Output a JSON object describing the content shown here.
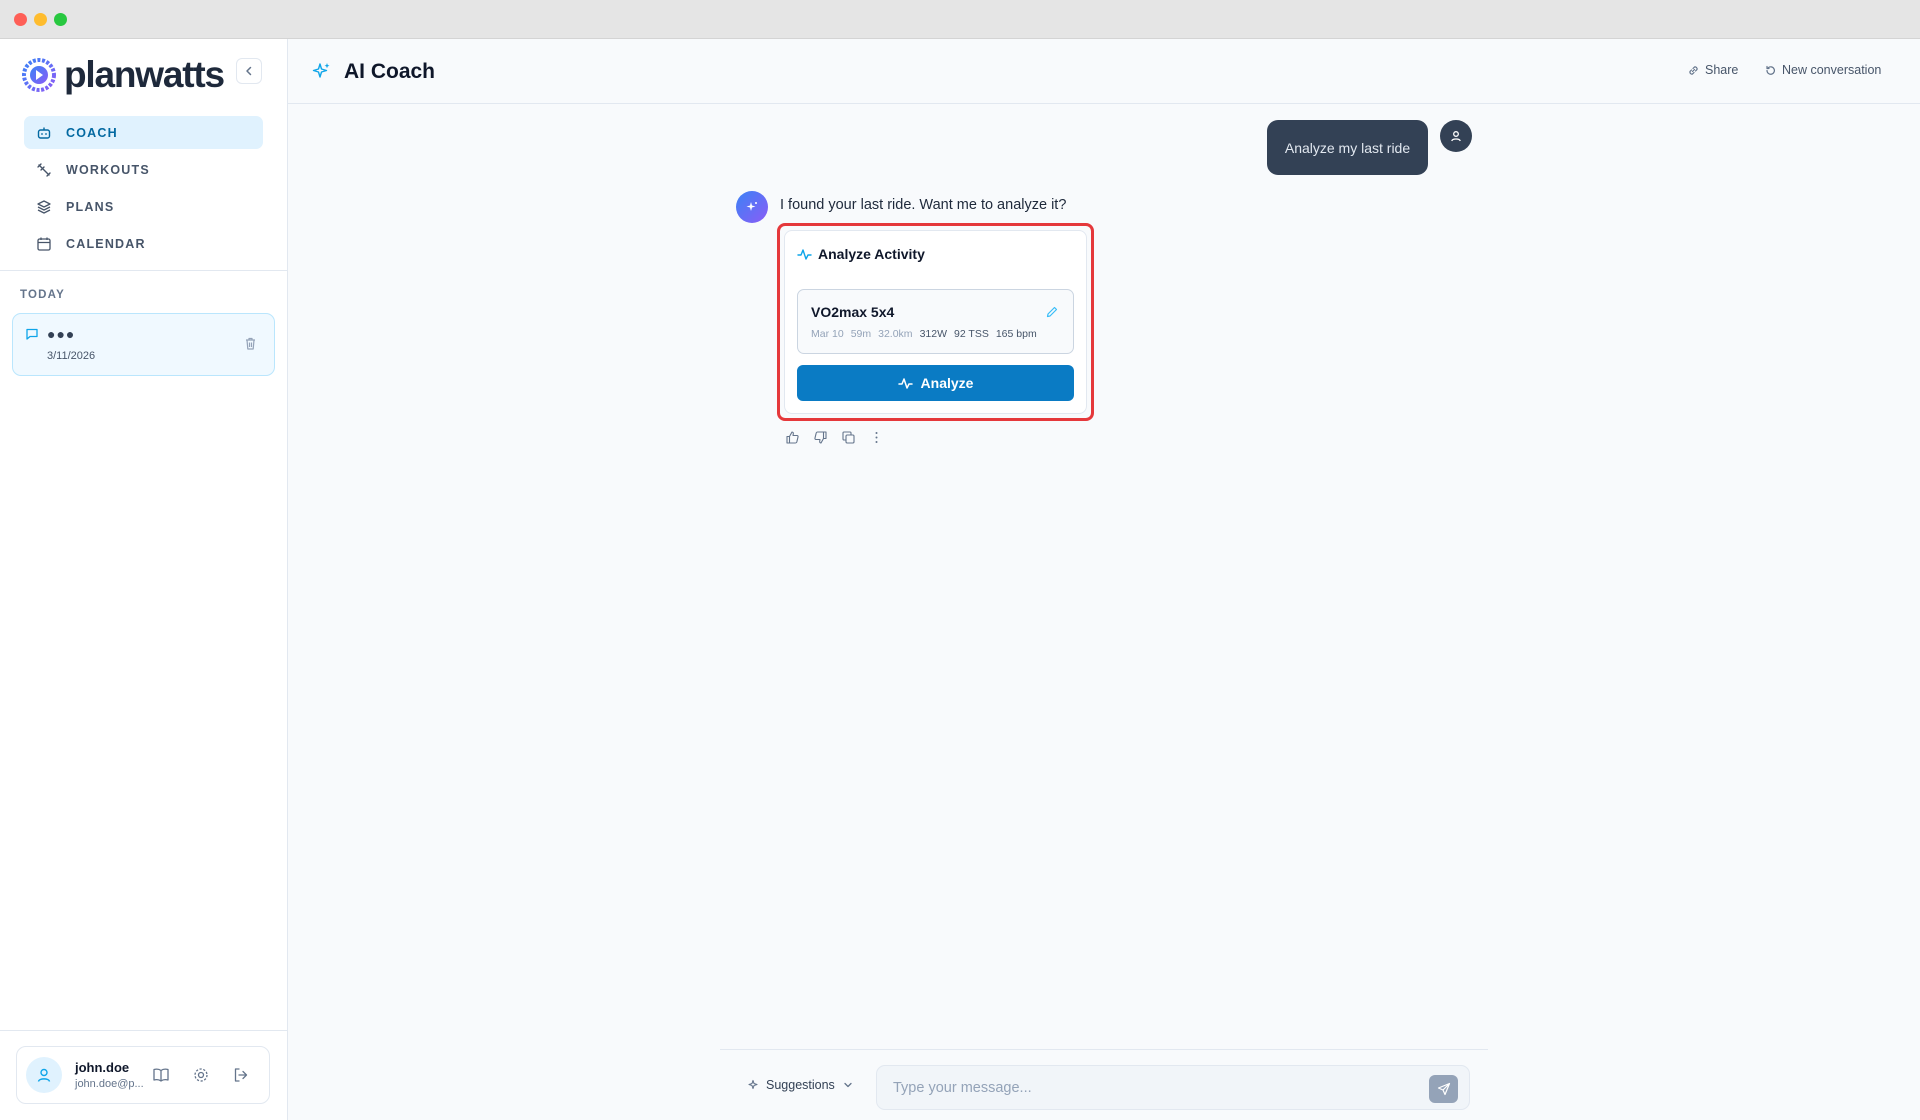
{
  "brand": {
    "name": "planwatts"
  },
  "nav": [
    {
      "label": "COACH",
      "icon": "bot-icon",
      "active": true
    },
    {
      "label": "WORKOUTS",
      "icon": "dumbbell-icon",
      "active": false
    },
    {
      "label": "PLANS",
      "icon": "layers-icon",
      "active": false
    },
    {
      "label": "CALENDAR",
      "icon": "calendar-icon",
      "active": false
    }
  ],
  "history": {
    "section_label": "TODAY",
    "items": [
      {
        "title": "●●●",
        "date": "3/11/2026"
      }
    ]
  },
  "user": {
    "name": "john.doe",
    "email": "john.doe@p..."
  },
  "header": {
    "title": "AI Coach",
    "share_label": "Share",
    "new_conversation_label": "New conversation"
  },
  "conversation": {
    "user_message": "Analyze my last ride",
    "assistant_message": "I found your last ride. Want me to analyze it?",
    "tool_card": {
      "title": "Analyze Activity",
      "activity": {
        "name": "VO2max 5x4",
        "date": "Mar 10",
        "duration": "59m",
        "distance": "32.0km",
        "power": "312W",
        "tss": "92 TSS",
        "heart_rate": "165 bpm"
      },
      "button_label": "Analyze"
    }
  },
  "composer": {
    "suggestions_label": "Suggestions",
    "placeholder": "Type your message..."
  },
  "colors": {
    "accent": "#0a7bc4",
    "highlight": "#e5383b",
    "active_nav_bg": "#e0f2fe"
  }
}
